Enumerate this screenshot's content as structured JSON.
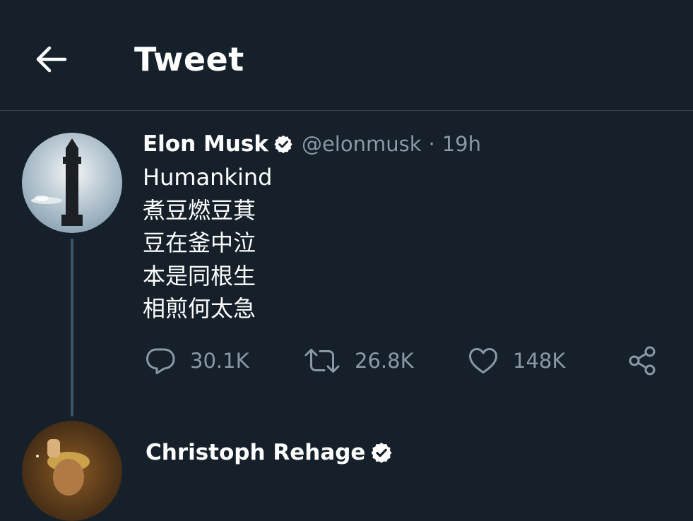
{
  "header": {
    "back_icon": "arrow-left-icon",
    "title": "Tweet"
  },
  "tweet": {
    "author": {
      "name": "Elon Musk",
      "handle": "@elonmusk",
      "verified_icon": "verified-badge-icon"
    },
    "separator": "·",
    "time": "19h",
    "lines": [
      "Humankind",
      "煮豆燃豆萁",
      "豆在釜中泣",
      "本是同根生",
      "相煎何太急"
    ],
    "actions": {
      "reply": {
        "icon": "reply-icon",
        "count": "30.1K"
      },
      "retweet": {
        "icon": "retweet-icon",
        "count": "26.8K"
      },
      "like": {
        "icon": "heart-icon",
        "count": "148K"
      },
      "share": {
        "icon": "share-icon"
      }
    }
  },
  "reply": {
    "author": {
      "name": "Christoph Rehage",
      "verified_icon": "verified-badge-icon"
    }
  },
  "colors": {
    "background": "#15202b",
    "text_primary": "#ffffff",
    "text_secondary": "#8b98a5",
    "divider": "#38444d"
  }
}
